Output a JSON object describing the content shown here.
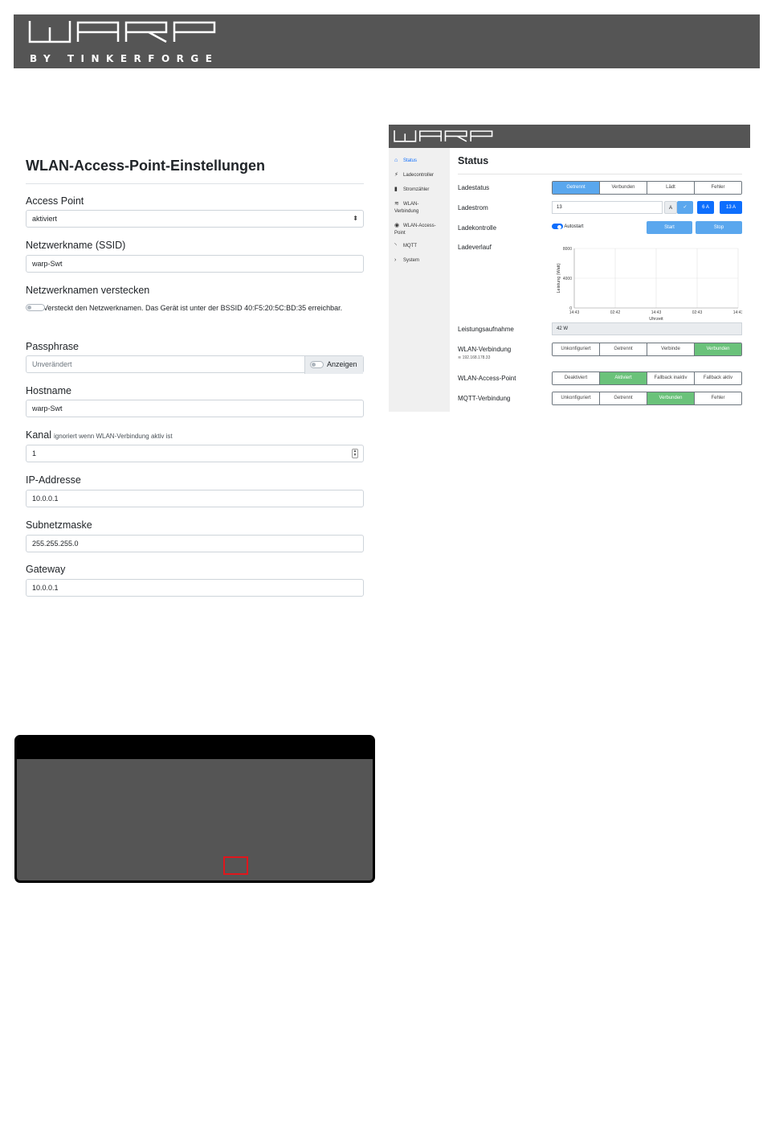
{
  "brand": {
    "logo_text": "WARP",
    "byline": "BY TINKERFORGE"
  },
  "form": {
    "title": "WLAN-Access-Point-Einstellungen",
    "access_point": {
      "label": "Access Point",
      "value": "aktiviert"
    },
    "ssid": {
      "label": "Netzwerkname (SSID)",
      "value": "warp-Swt"
    },
    "hide": {
      "label": "Netzwerknamen verstecken",
      "description": "Versteckt den Netzwerknamen. Das Gerät ist unter der BSSID 40:F5:20:5C:BD:35 erreichbar."
    },
    "passphrase": {
      "label": "Passphrase",
      "placeholder": "Unverändert",
      "show_label": "Anzeigen"
    },
    "hostname": {
      "label": "Hostname",
      "value": "warp-Swt"
    },
    "channel": {
      "label": "Kanal",
      "hint": "ignoriert wenn WLAN-Verbindung aktiv ist",
      "value": "1"
    },
    "ip": {
      "label": "IP-Addresse",
      "value": "10.0.0.1"
    },
    "subnet": {
      "label": "Subnetzmaske",
      "value": "255.255.255.0"
    },
    "gateway": {
      "label": "Gateway",
      "value": "10.0.0.1"
    }
  },
  "status_screenshot": {
    "sidebar": [
      {
        "icon": "home-icon",
        "glyph": "⌂",
        "label": "Status",
        "active": true
      },
      {
        "icon": "charger-icon",
        "glyph": "⚡",
        "label": "Ladecontroller"
      },
      {
        "icon": "meter-icon",
        "glyph": "▮",
        "label": "Stromzähler"
      },
      {
        "icon": "wifi-icon",
        "glyph": "≋",
        "label": "WLAN-\nVerbindung"
      },
      {
        "icon": "access-point-icon",
        "glyph": "◉",
        "label": "WLAN-Access-\nPoint"
      },
      {
        "icon": "rss-icon",
        "glyph": "◝",
        "label": "MQTT"
      },
      {
        "icon": "chevron-right-icon",
        "glyph": "›",
        "label": "System"
      }
    ],
    "title": "Status",
    "ladestatus": {
      "label": "Ladestatus",
      "options": [
        "Getrennt",
        "Verbunden",
        "Lädt",
        "Fehler"
      ],
      "active": 0
    },
    "ladestrom": {
      "label": "Ladestrom",
      "value": "13",
      "unit": "A",
      "btn_6": "6 A",
      "btn_13": "13 A"
    },
    "ladekontrolle": {
      "label": "Ladekontrolle",
      "autostart": "Autostart",
      "start": "Start",
      "stop": "Stop"
    },
    "ladeverlauf": {
      "label": "Ladeverlauf"
    },
    "leistung": {
      "label": "Leistungsaufnahme",
      "value": "42 W"
    },
    "wlan": {
      "label": "WLAN-Verbindung",
      "ip": "192.168.178.33",
      "options": [
        "Unkonfiguriert",
        "Getrennt",
        "Verbinde",
        "Verbunden"
      ],
      "active": 3
    },
    "ap": {
      "label": "WLAN-Access-Point",
      "options": [
        "Deaktiviert",
        "Aktiviert",
        "Fallback inaktiv",
        "Fallback aktiv"
      ],
      "active": 1
    },
    "mqtt": {
      "label": "MQTT-Verbindung",
      "options": [
        "Unkonfiguriert",
        "Getrennt",
        "Verbunden",
        "Fehler"
      ],
      "active": 2
    },
    "colors": {
      "active_blue": "#5aa7ee",
      "active_green": "#6ac27a",
      "primary": "#0d6efd"
    }
  },
  "chart_data": {
    "type": "line",
    "title": "",
    "xlabel": "Uhrzeit",
    "ylabel": "Leistung (Watt)",
    "x_ticks": [
      "14:43",
      "02:42",
      "14:43",
      "02:43",
      "14:43"
    ],
    "y_ticks": [
      0,
      4000,
      8000
    ],
    "ylim": [
      0,
      8000
    ],
    "grid": true,
    "series": []
  }
}
